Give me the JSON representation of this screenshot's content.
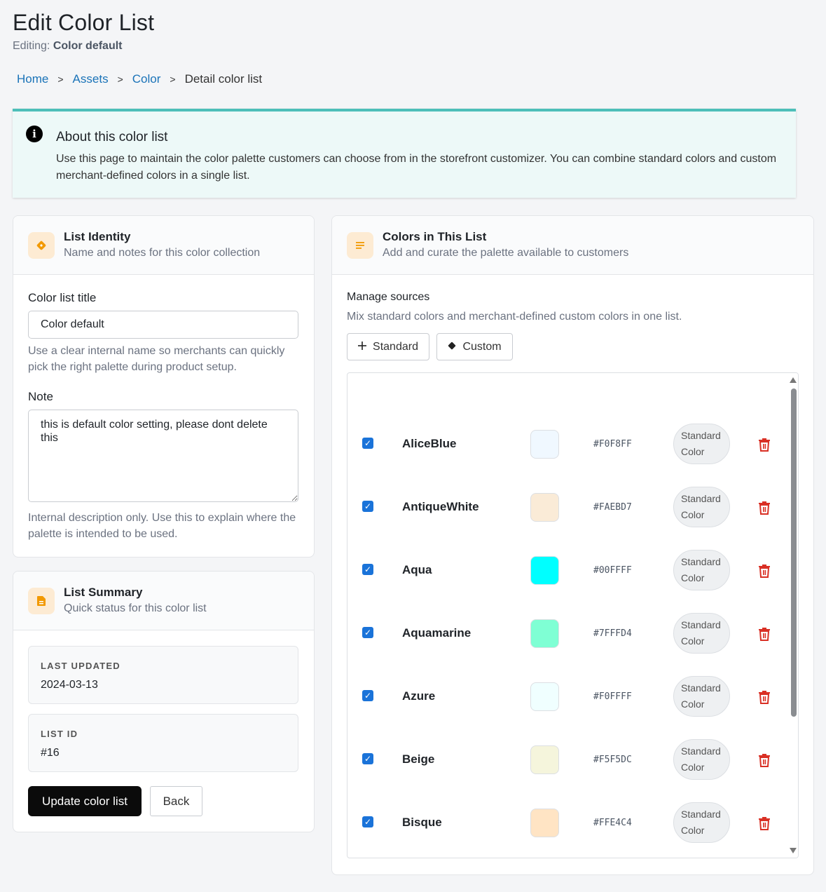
{
  "header": {
    "title": "Edit Color List",
    "editing_label": "Editing:",
    "editing_value": "Color default"
  },
  "breadcrumb": {
    "items": [
      "Home",
      "Assets",
      "Color"
    ],
    "separator": ">",
    "current": "Detail color list"
  },
  "info": {
    "title": "About this color list",
    "text": "Use this page to maintain the color palette customers can choose from in the storefront customizer. You can combine standard colors and custom merchant-defined colors in a single list."
  },
  "identity": {
    "title": "List Identity",
    "subtitle": "Name and notes for this color collection",
    "title_label": "Color list title",
    "title_value": "Color default",
    "title_help": "Use a clear internal name so merchants can quickly pick the right palette during product setup.",
    "note_label": "Note",
    "note_value": "this is default color setting, please dont delete this",
    "note_help": "Internal description only. Use this to explain where the palette is intended to be used."
  },
  "summary": {
    "title": "List Summary",
    "subtitle": "Quick status for this color list",
    "last_updated_label": "LAST UPDATED",
    "last_updated_value": "2024-03-13",
    "list_id_label": "LIST ID",
    "list_id_value": "#16",
    "update_button": "Update color list",
    "back_button": "Back"
  },
  "colors_panel": {
    "title": "Colors in This List",
    "subtitle": "Add and curate the palette available to customers",
    "manage_title": "Manage sources",
    "manage_help": "Mix standard colors and merchant-defined custom colors in one list.",
    "standard_button": "Standard",
    "custom_button": "Custom",
    "rows": [
      {
        "name": "AliceBlue",
        "hex": "#F0F8FF",
        "swatch": "#F0F8FF",
        "type_line1": "Standard",
        "type_line2": "Color",
        "checked": true
      },
      {
        "name": "AntiqueWhite",
        "hex": "#FAEBD7",
        "swatch": "#FAEBD7",
        "type_line1": "Standard",
        "type_line2": "Color",
        "checked": true
      },
      {
        "name": "Aqua",
        "hex": "#00FFFF",
        "swatch": "#00FFFF",
        "type_line1": "Standard",
        "type_line2": "Color",
        "checked": true
      },
      {
        "name": "Aquamarine",
        "hex": "#7FFFD4",
        "swatch": "#7FFFD4",
        "type_line1": "Standard",
        "type_line2": "Color",
        "checked": true
      },
      {
        "name": "Azure",
        "hex": "#F0FFFF",
        "swatch": "#F0FFFF",
        "type_line1": "Standard",
        "type_line2": "Color",
        "checked": true
      },
      {
        "name": "Beige",
        "hex": "#F5F5DC",
        "swatch": "#F5F5DC",
        "type_line1": "Standard",
        "type_line2": "Color",
        "checked": true
      },
      {
        "name": "Bisque",
        "hex": "#FFE4C4",
        "swatch": "#FFE4C4",
        "type_line1": "Standard",
        "type_line2": "Color",
        "checked": true
      }
    ]
  },
  "colors": {
    "accent": "#4dbfb9",
    "link": "#1a73b8",
    "checkbox": "#1a73d9",
    "danger": "#d93025",
    "icon_bg": "#fdebd3",
    "icon_fg": "#f29900"
  }
}
